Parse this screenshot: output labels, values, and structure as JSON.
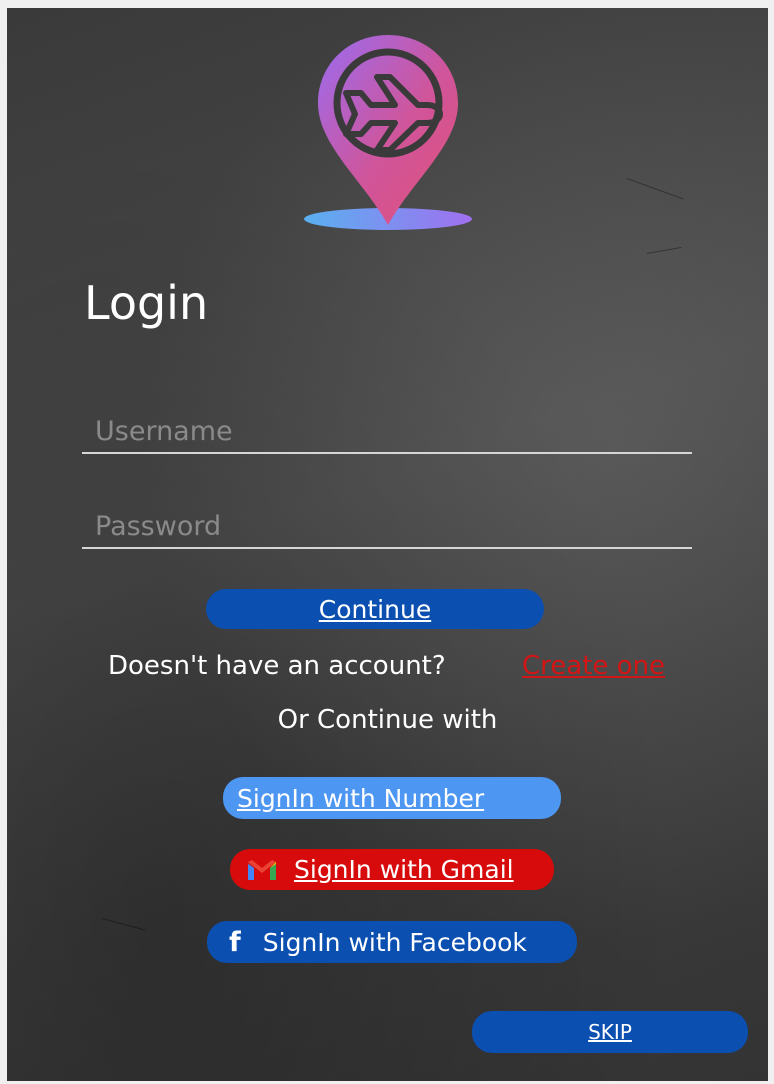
{
  "login": {
    "title": "Login",
    "username_placeholder": "Username",
    "password_placeholder": "Password",
    "continue_label": "Continue",
    "no_account_text": "Doesn't have an account?",
    "create_label": "Create one",
    "or_text": "Or Continue with",
    "signin_number_label": "SignIn with Number",
    "signin_gmail_label": "SignIn with Gmail",
    "signin_facebook_label": "SignIn with Facebook",
    "facebook_glyph": "f",
    "skip_label": "SKIP"
  },
  "icons": {
    "logo": "airplane-location-pin-icon",
    "gmail": "gmail-icon",
    "facebook": "facebook-icon"
  },
  "colors": {
    "primary_blue": "#0b4fb0",
    "light_blue": "#4d96f2",
    "gmail_red": "#d70b0b",
    "link_red": "#d41515",
    "logo_gradient_start": "#e0507a",
    "logo_gradient_end": "#9a6cf0"
  }
}
